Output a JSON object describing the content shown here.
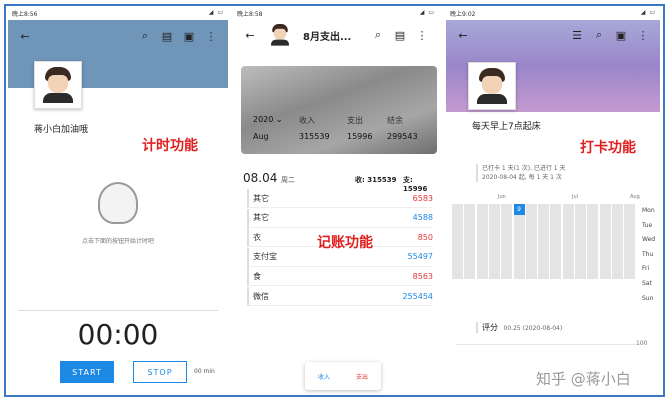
{
  "timer_screen": {
    "status_time": "晚上8:56",
    "username": "蒋小白加油哦",
    "feature_label": "计时功能",
    "hint": "点击下面的按钮开始计时吧",
    "time": "00:00",
    "start_label": "START",
    "stop_label": "STOP",
    "minutes": "00 min"
  },
  "ledger_screen": {
    "status_time": "晚上8:58",
    "title": "8月支出...",
    "year": "2020",
    "month": "Aug",
    "income_label": "收入",
    "expense_label": "支出",
    "balance_label": "结余",
    "income_value": "315539",
    "expense_value": "15996",
    "balance_value": "299543",
    "date": "08.04",
    "weekday": "周二",
    "day_income": "收: 315539",
    "day_expense": "支: 15996",
    "feature_label": "记账功能",
    "rows": [
      {
        "name": "其它",
        "amount": "6583",
        "color": "#e53935"
      },
      {
        "name": "其它",
        "amount": "4588",
        "color": "#1e88e5"
      },
      {
        "name": "衣",
        "amount": "850",
        "color": "#e53935"
      },
      {
        "name": "支付宝",
        "amount": "55497",
        "color": "#1e88e5"
      },
      {
        "name": "食",
        "amount": "8563",
        "color": "#e53935"
      },
      {
        "name": "微信",
        "amount": "255454",
        "color": "#1e88e5"
      }
    ],
    "tab_income": "收入",
    "tab_expense": "支出"
  },
  "checkin_screen": {
    "status_time": "晚上9:02",
    "goal": "每天早上7点起床",
    "feature_label": "打卡功能",
    "summary_line1": "已打卡 1 天(1 次), 已进行 1 天",
    "summary_line2": "2020-08-04 起, 每 1 天 1 次",
    "months": [
      "Jun",
      "Jul",
      "Aug"
    ],
    "weekdays": [
      "Mon",
      "Tue",
      "Wed",
      "Thu",
      "Fri",
      "Sat",
      "Sun"
    ],
    "highlight_day": "9",
    "score_label": "评分",
    "score_value": "00.25 (2020-08-04)",
    "axis_value": "100"
  },
  "watermark": "知乎 @蒋小白",
  "colors": {
    "accent": "#1e88e5",
    "red": "#e02020",
    "border": "#3a78c3"
  }
}
